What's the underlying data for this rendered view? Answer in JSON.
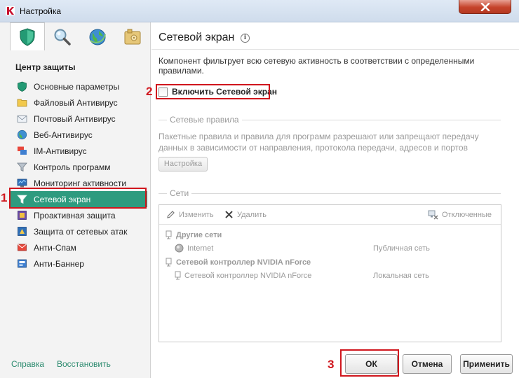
{
  "window": {
    "title": "Настройка"
  },
  "sidebar": {
    "tabs": [
      {
        "icon": "shield-icon",
        "active": true
      },
      {
        "icon": "magnifier-icon",
        "active": false
      },
      {
        "icon": "globe-icon",
        "active": false
      },
      {
        "icon": "safe-icon",
        "active": false
      }
    ],
    "section_title": "Центр защиты",
    "items": [
      {
        "label": "Основные параметры",
        "icon": "shield-icon"
      },
      {
        "label": "Файловый Антивирус",
        "icon": "folder-icon"
      },
      {
        "label": "Почтовый Антивирус",
        "icon": "mail-icon"
      },
      {
        "label": "Веб-Антивирус",
        "icon": "globe-icon"
      },
      {
        "label": "IM-Антивирус",
        "icon": "im-icon"
      },
      {
        "label": "Контроль программ",
        "icon": "filter-icon"
      },
      {
        "label": "Мониторинг активности",
        "icon": "monitor-icon"
      },
      {
        "label": "Сетевой экран",
        "icon": "firewall-icon",
        "selected": true
      },
      {
        "label": "Проактивная защита",
        "icon": "proactive-icon"
      },
      {
        "label": "Защита от сетевых атак",
        "icon": "network-attack-icon"
      },
      {
        "label": "Анти-Спам",
        "icon": "antispam-icon"
      },
      {
        "label": "Анти-Баннер",
        "icon": "antibanner-icon"
      }
    ],
    "footer": {
      "help": "Справка",
      "restore": "Восстановить"
    }
  },
  "main": {
    "title": "Сетевой экран",
    "description": "Компонент фильтрует всю сетевую активность в соответствии с определенными правилами.",
    "enable_checkbox": {
      "label": "Включить Сетевой экран",
      "checked": false
    },
    "rules_group": {
      "title": "Сетевые правила",
      "description": "Пакетные правила и правила для программ разрешают или запрещают передачу данных в зависимости от направления, протокола передачи, адресов и портов назначения.",
      "settings_button": "Настройка"
    },
    "networks_group": {
      "title": "Сети",
      "toolbar": {
        "edit": "Изменить",
        "delete": "Удалить",
        "disconnected": "Отключенные"
      },
      "groups": [
        {
          "name": "Другие сети",
          "rows": [
            {
              "name": "Internet",
              "type": "Публичная сеть"
            }
          ]
        },
        {
          "name": "Сетевой контроллер NVIDIA nForce",
          "rows": [
            {
              "name": "Сетевой контроллер NVIDIA nForce",
              "type": "Локальная сеть"
            }
          ]
        }
      ]
    }
  },
  "buttons": {
    "ok": "ОК",
    "cancel": "Отмена",
    "apply": "Применить"
  },
  "annotations": [
    "1",
    "2",
    "3"
  ],
  "colors": {
    "accent": "#2e9b7f",
    "annotation": "#d0161d",
    "link": "#2b8a6e"
  }
}
